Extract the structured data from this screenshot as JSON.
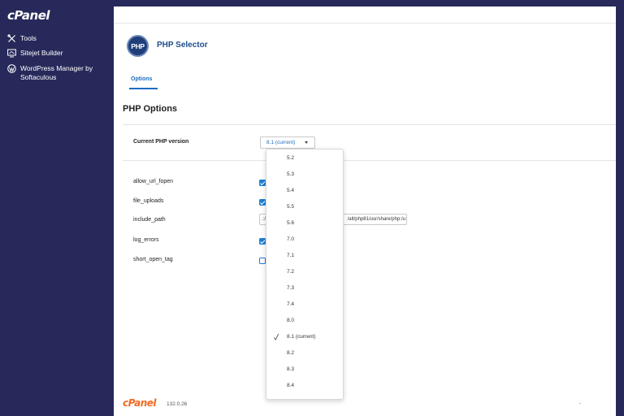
{
  "sidebar": {
    "logo": "cPanel",
    "items": [
      {
        "label": "Tools",
        "icon": "tools-icon"
      },
      {
        "label": "Sitejet Builder",
        "icon": "monitor-icon"
      },
      {
        "label": "WordPress Manager by Softaculous",
        "icon": "wordpress-icon"
      }
    ]
  },
  "header": {
    "app_icon_text": "PHP",
    "title": "PHP Selector"
  },
  "tabs": [
    {
      "label": "Options",
      "active": true
    }
  ],
  "section_title": "PHP Options",
  "current_version": {
    "label": "Current PHP version",
    "selected": "8.1 (current)"
  },
  "options": {
    "allow_url_fopen": {
      "label": "allow_url_fopen",
      "checked": true
    },
    "file_uploads": {
      "label": "file_uploads",
      "checked": true
    },
    "include_path": {
      "label": "include_path",
      "value_start": ".:/",
      "value_end": "/alt/php81/usr/share/php:/u"
    },
    "log_errors": {
      "label": "log_errors",
      "checked": true
    },
    "short_open_tag": {
      "label": "short_open_tag",
      "checked": false
    }
  },
  "dropdown": {
    "options": [
      "5.2",
      "5.3",
      "5.4",
      "5.5",
      "5.6",
      "7.0",
      "7.1",
      "7.2",
      "7.3",
      "7.4",
      "8.0",
      "8.1 (current)",
      "8.2",
      "8.3",
      "8.4"
    ],
    "selected": "8.1 (current)"
  },
  "footer": {
    "logo": "cPanel",
    "version": "132.0.26"
  },
  "colors": {
    "sidebar_bg": "#27295a",
    "accent": "#1c6ec2",
    "title": "#1f4f8c",
    "footer_logo": "#f26a21"
  }
}
